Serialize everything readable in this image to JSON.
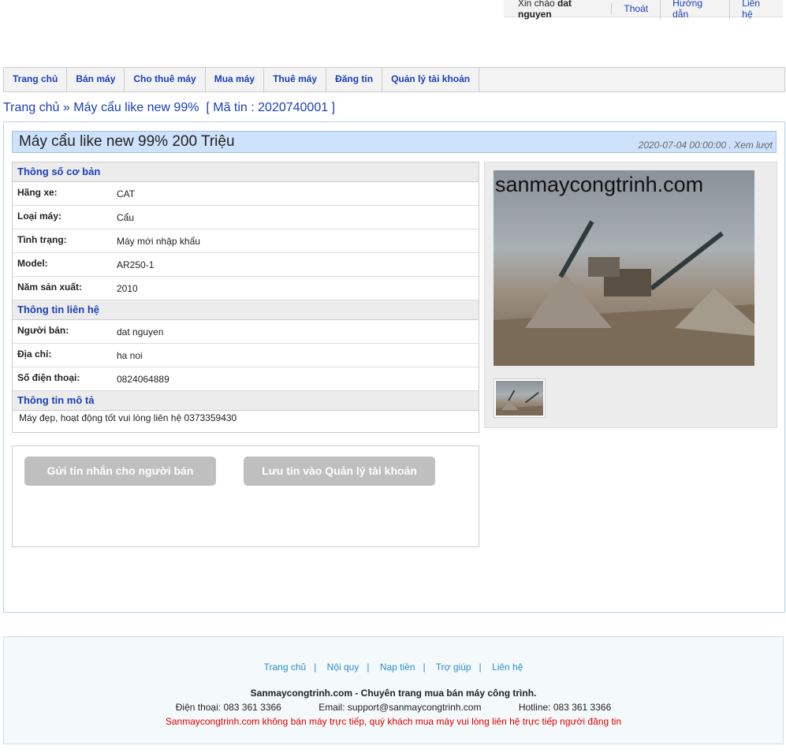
{
  "topbar": {
    "greeting": "Xin chào",
    "username": "dat nguyen",
    "links": [
      "Thoát",
      "Hướng dẫn",
      "Liên hệ"
    ]
  },
  "nav": {
    "tabs": [
      "Trang chủ",
      "Bán máy",
      "Cho thuê máy",
      "Mua máy",
      "Thuê máy",
      "Đăng tin",
      "Quản lý tài khoản"
    ]
  },
  "breadcrumb": {
    "home": "Trang chủ",
    "separator": "»",
    "current": "Máy cẩu like new 99%",
    "code": "[ Mã tin : 2020740001 ]"
  },
  "listing": {
    "title": "Máy cẩu like new 99% 200 Triệu",
    "meta": "2020-07-04 00:00:00 . Xem lượt"
  },
  "basic": {
    "heading": "Thông số cơ bản",
    "rows": [
      {
        "label": "Hãng xe:",
        "value": "CAT"
      },
      {
        "label": "Loại máy:",
        "value": "Cẩu"
      },
      {
        "label": "Tình trạng:",
        "value": "Máy mới nhập khẩu"
      },
      {
        "label": "Model:",
        "value": "AR250-1"
      },
      {
        "label": "Năm sản xuất:",
        "value": "2010"
      }
    ]
  },
  "contact": {
    "heading": "Thông tin liên hệ",
    "rows": [
      {
        "label": "Người bán:",
        "value": "dat nguyen"
      },
      {
        "label": "Địa chỉ:",
        "value": "ha noi"
      },
      {
        "label": "Số điện thoại:",
        "value": "0824064889"
      }
    ]
  },
  "description": {
    "heading": "Thông tin mô tả",
    "text": "Máy đẹp, hoạt động tốt vui lòng liên hệ 0373359430"
  },
  "gallery": {
    "watermark": "sanmaycongtrinh.com"
  },
  "actions": {
    "message_button": "Gửi tin nhắn cho người bán",
    "save_button": "Lưu tin vào Quản lý tài khoản"
  },
  "footer": {
    "links": [
      "Trang chủ",
      "Nội quy",
      "Nạp tiền",
      "Trợ giúp",
      "Liên hệ"
    ],
    "brand": "Sanmaycongtrinh.com - Chuyên trang mua bán máy công trình.",
    "phone": "Điện thoại: 083 361 3366",
    "email": "Email: support@sanmaycongtrinh.com",
    "hotline": "Hotline: 083 361 3366",
    "notice": "Sanmaycongtrinh.com không bán máy trực tiếp, quý khách mua máy vui lòng liên hệ trực tiếp người đăng tin"
  }
}
